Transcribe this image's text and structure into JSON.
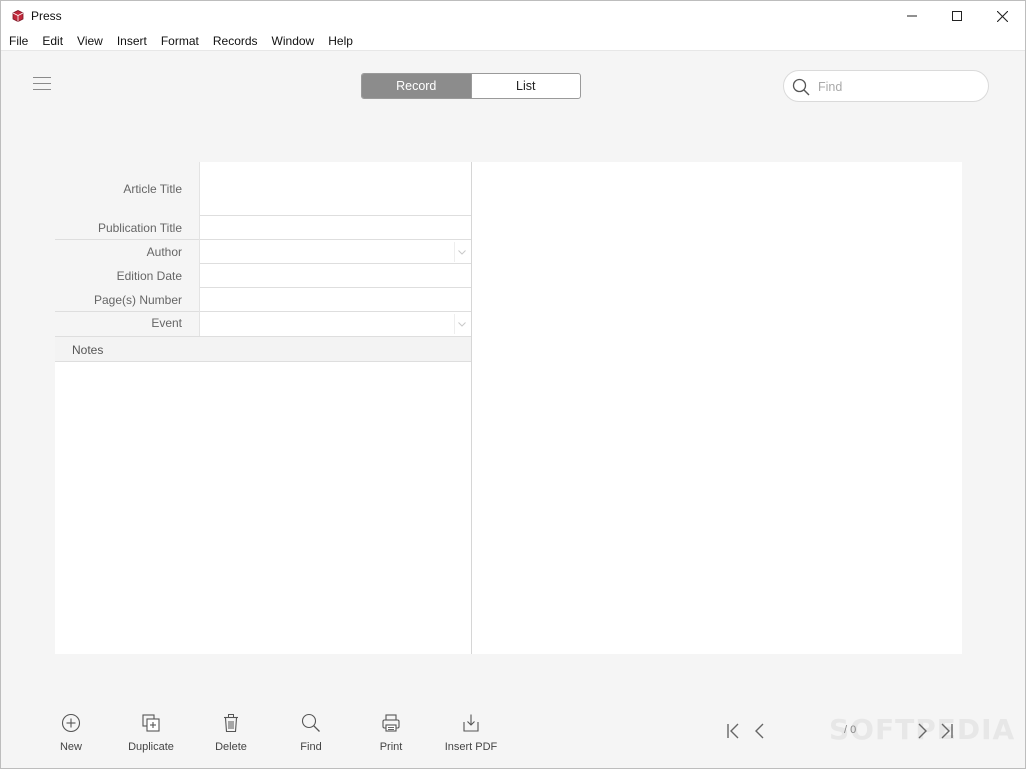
{
  "app": {
    "title": "Press"
  },
  "menubar": {
    "items": [
      {
        "label": "File"
      },
      {
        "label": "Edit"
      },
      {
        "label": "View"
      },
      {
        "label": "Insert"
      },
      {
        "label": "Format"
      },
      {
        "label": "Records"
      },
      {
        "label": "Window"
      },
      {
        "label": "Help"
      }
    ]
  },
  "view_toggle": {
    "record_label": "Record",
    "list_label": "List",
    "active": "Record"
  },
  "search": {
    "placeholder": "Find",
    "value": ""
  },
  "form": {
    "fields": [
      {
        "label": "Article Title",
        "value": ""
      },
      {
        "label": "Publication Title",
        "value": ""
      },
      {
        "label": "Author",
        "value": ""
      },
      {
        "label": "Edition Date",
        "value": ""
      },
      {
        "label": "Page(s) Number",
        "value": ""
      },
      {
        "label": "Event",
        "value": ""
      }
    ],
    "notes_label": "Notes",
    "notes_value": ""
  },
  "bottom_toolbar": {
    "new_label": "New",
    "duplicate_label": "Duplicate",
    "delete_label": "Delete",
    "find_label": "Find",
    "print_label": "Print",
    "insert_pdf_label": "Insert PDF"
  },
  "pager": {
    "record_count": "/ 0"
  },
  "watermark": "SOFTPEDIA"
}
